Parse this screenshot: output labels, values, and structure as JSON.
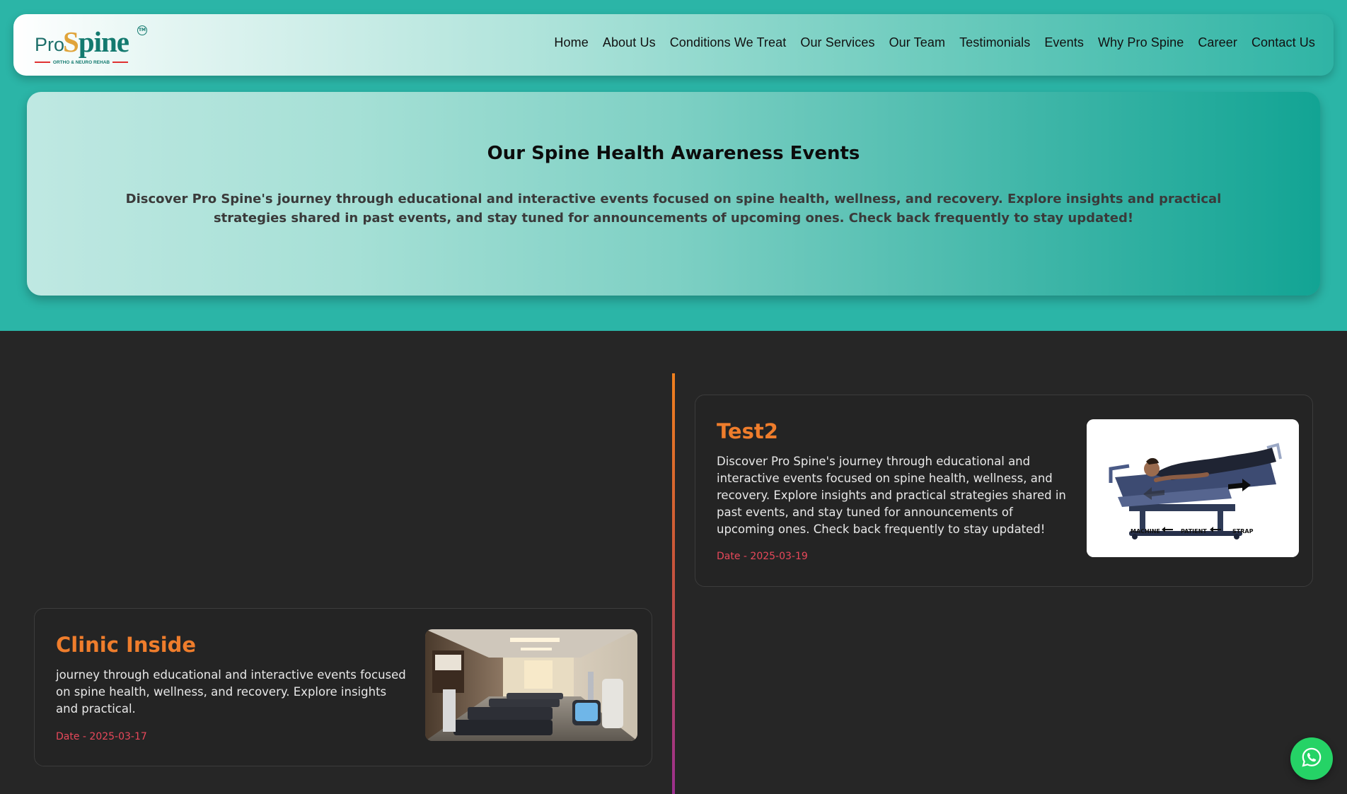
{
  "logo": {
    "pro": "Pro",
    "spine_s": "S",
    "spine_rest": "pine",
    "tm": "TM",
    "tagline": "ORTHO & NEURO REHAB"
  },
  "nav": {
    "items": [
      {
        "label": "Home"
      },
      {
        "label": "About Us"
      },
      {
        "label": "Conditions We Treat"
      },
      {
        "label": "Our Services"
      },
      {
        "label": "Our Team"
      },
      {
        "label": "Testimonials"
      },
      {
        "label": "Events"
      },
      {
        "label": "Why Pro Spine"
      },
      {
        "label": "Career"
      },
      {
        "label": "Contact Us"
      }
    ]
  },
  "hero": {
    "title": "Our Spine Health Awareness Events",
    "description": "Discover Pro Spine's journey through educational and interactive events focused on spine health, wellness, and recovery. Explore insights and practical strategies shared in past events, and stay tuned for announcements of upcoming ones. Check back frequently to stay updated!"
  },
  "events": [
    {
      "title": "Test2",
      "description": "Discover Pro Spine's journey through educational and interactive events focused on spine health, wellness, and recovery. Explore insights and practical strategies shared in past events, and stay tuned for announcements of upcoming ones. Check back frequently to stay updated!",
      "date": "Date - 2025-03-19",
      "image_labels": {
        "machine": "MACHINE",
        "patient": "PATIENT",
        "strap": "STRAP"
      }
    },
    {
      "title": "Clinic Inside",
      "description": "journey through educational and interactive events focused on spine health, wellness, and recovery. Explore insights and practical.",
      "date": "Date - 2025-03-17"
    }
  ],
  "colors": {
    "teal_band": "#2bb5a7",
    "dark_background": "#262626",
    "event_title": "#ef7d2c",
    "event_date": "#e8485a",
    "whatsapp_green": "#25d366"
  },
  "icons": {
    "floating_button": "whatsapp-icon"
  }
}
